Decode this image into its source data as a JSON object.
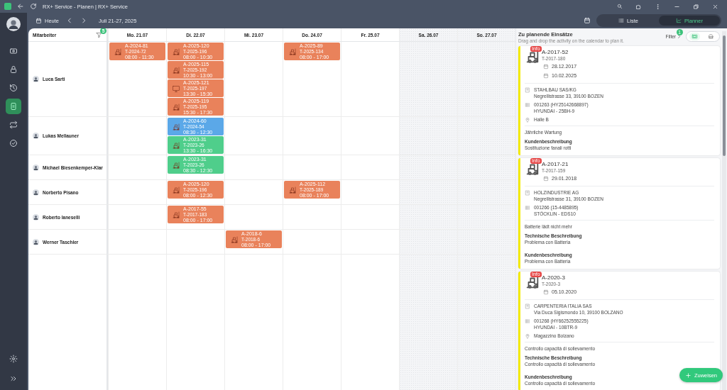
{
  "window": {
    "title": "RX+ Service - Planen | RX+ Service"
  },
  "sidebar": {
    "items": [
      {
        "kind": "ticket",
        "selected": false
      },
      {
        "kind": "lock",
        "selected": false
      },
      {
        "kind": "history",
        "selected": false
      },
      {
        "kind": "phone",
        "selected": true
      },
      {
        "kind": "repeat",
        "selected": false
      },
      {
        "kind": "check",
        "selected": false
      }
    ],
    "bottom_items": [
      {
        "kind": "settings",
        "selected": false
      },
      {
        "kind": "expand",
        "selected": false
      }
    ]
  },
  "toolbar": {
    "today": "Heute",
    "range": "Juli 21-27, 2025",
    "views": [
      {
        "label": "Liste",
        "kind": "list",
        "selected": false
      },
      {
        "label": "Planner",
        "kind": "planner",
        "selected": true
      }
    ]
  },
  "calendar": {
    "employee_header": "Mitarbeiter",
    "filter_badge": "5",
    "days": [
      {
        "label": "Mo. 21.07",
        "weekend": false
      },
      {
        "label": "Di. 22.07",
        "weekend": false
      },
      {
        "label": "Mi. 23.07",
        "weekend": false
      },
      {
        "label": "Do. 24.07",
        "weekend": false
      },
      {
        "label": "Fr. 25.07",
        "weekend": false
      },
      {
        "label": "Sa. 26.07",
        "weekend": true
      },
      {
        "label": "So. 27.07",
        "weekend": true
      }
    ],
    "rows": [
      {
        "name": "Luca Sarti",
        "cells": [
          [
            {
              "order": "A-2024-81",
              "ticket": "T-2024-72",
              "time": "08:00 - 11:30",
              "color": "#e9825b",
              "kind": "forklift"
            }
          ],
          [
            {
              "order": "A-2025-120",
              "ticket": "T-2025-196",
              "time": "08:00 - 10:30",
              "color": "#e9825b",
              "kind": "forklift"
            },
            {
              "order": "A-2025-115",
              "ticket": "T-2025-192",
              "time": "10:30 - 13:00",
              "color": "#e9825b",
              "kind": "forklift"
            },
            {
              "order": "A-2025-121",
              "ticket": "T-2025-197",
              "time": "13:30 - 15:30",
              "color": "#e9825b",
              "kind": "monitor"
            },
            {
              "order": "A-2025-119",
              "ticket": "T-2025-195",
              "time": "15:30 - 17:30",
              "color": "#e9825b",
              "kind": "forklift"
            }
          ],
          null,
          [
            {
              "order": "A-2025-89",
              "ticket": "T-2025-134",
              "time": "08:00 - 17:00",
              "color": "#e9825b",
              "kind": "forklift"
            }
          ],
          null,
          null,
          null
        ]
      },
      {
        "name": "Lukas Mellauner",
        "cells": [
          null,
          [
            {
              "order": "A-2024-60",
              "ticket": "T-2024-54",
              "time": "08:30 - 12:30",
              "color": "#5ba8e8",
              "kind": "forklift"
            },
            {
              "order": "A-2023-31",
              "ticket": "T-2023-26",
              "time": "13:30 - 16:30",
              "color": "#4fce8b",
              "kind": "forklift"
            }
          ],
          null,
          null,
          null,
          null,
          null
        ]
      },
      {
        "name": "Michael Biesenkemper-Klar",
        "cells": [
          null,
          [
            {
              "order": "A-2023-31",
              "ticket": "T-2023-26",
              "time": "08:30 - 12:30",
              "color": "#4fce8b",
              "kind": "forklift"
            }
          ],
          null,
          null,
          null,
          null,
          null
        ]
      },
      {
        "name": "Norberto Pisano",
        "cells": [
          null,
          [
            {
              "order": "A-2025-120",
              "ticket": "T-2025-196",
              "time": "08:00 - 12:30",
              "color": "#e9825b",
              "kind": "forklift"
            }
          ],
          null,
          [
            {
              "order": "A-2025-112",
              "ticket": "T-2025-189",
              "time": "08:00 - 17:00",
              "color": "#e9825b",
              "kind": "forklift"
            }
          ],
          null,
          null,
          null
        ]
      },
      {
        "name": "Roberto Ianeselli",
        "cells": [
          null,
          [
            {
              "order": "A-2017-55",
              "ticket": "T-2017-183",
              "time": "08:00 - 17:00",
              "color": "#e9825b",
              "kind": "forklift"
            }
          ],
          null,
          null,
          null,
          null,
          null
        ]
      },
      {
        "name": "Werner Taschler",
        "cells": [
          null,
          null,
          [
            {
              "order": "A-2018-6",
              "ticket": "T-2018-6",
              "time": "08:00 - 17:00",
              "color": "#e9825b",
              "kind": "forklift"
            }
          ],
          null,
          null,
          null,
          null
        ]
      }
    ]
  },
  "panel": {
    "title": "Zu planende Einsätze",
    "subtitle": "Drag and drop the activity on the calendar to plan it.",
    "filter": "Filter",
    "filter_badge": "1",
    "view_toggle": [
      {
        "kind": "card",
        "selected": true
      },
      {
        "kind": "vehicle",
        "selected": false
      }
    ],
    "cards": [
      {
        "badge": "Info",
        "order": "A-2017-52",
        "ticket": "T-2017-180",
        "dates": [
          "28.12.2017",
          "10.02.2025"
        ],
        "customer": "STAHLBAU SAS/KG",
        "address": "Negrellistrasse 33, 39100 BOZEN",
        "serial": "001263 (HY25142668897)",
        "model": "HYUNDAI - 25BH-9",
        "location": "Halle B",
        "summary": "Jährliche Wartung",
        "sections": [
          {
            "heading": "Kundenbeschreibung",
            "text": "Sostituzione fanali rotti"
          }
        ]
      },
      {
        "badge": "Info",
        "order": "A-2017-21",
        "ticket": "T-2017-159",
        "dates": [
          "29.01.2018"
        ],
        "customer": "HOLZINDUSTRIE AG",
        "address": "Negrellistrasse 31, 39100 BOZEN",
        "serial": "001266 (15-4485895)",
        "model": "STÖCKLIN - EDS10",
        "summary": "Batterie lädt nicht mehr",
        "sections": [
          {
            "heading": "Technische Beschreibung",
            "text": "Problema con Batteria"
          },
          {
            "heading": "Kundenbeschreibung",
            "text": "Problema con Batteria"
          }
        ]
      },
      {
        "badge": "Info",
        "order": "A-2020-3",
        "ticket": "T-2020-3",
        "dates": [
          "05.10.2020"
        ],
        "customer": "CARPENTERIA ITALIA SAS",
        "address": "Via Duca Sigismondo 10, 39100 BOLZANO",
        "serial": "001268 (HY66252555225)",
        "model": "HYUNDAI - 10BTR-9",
        "location": "Magazzino Bolzano",
        "summary": "Controllo capacità di sollevamento",
        "sections": [
          {
            "heading": "Technische Beschreibung",
            "text": "Controllo capacità di sollevamento"
          },
          {
            "heading": "Kundenbeschreibung",
            "text": "Controllo capacità di sollevamento"
          }
        ]
      }
    ],
    "fab": "Zuweisen"
  }
}
